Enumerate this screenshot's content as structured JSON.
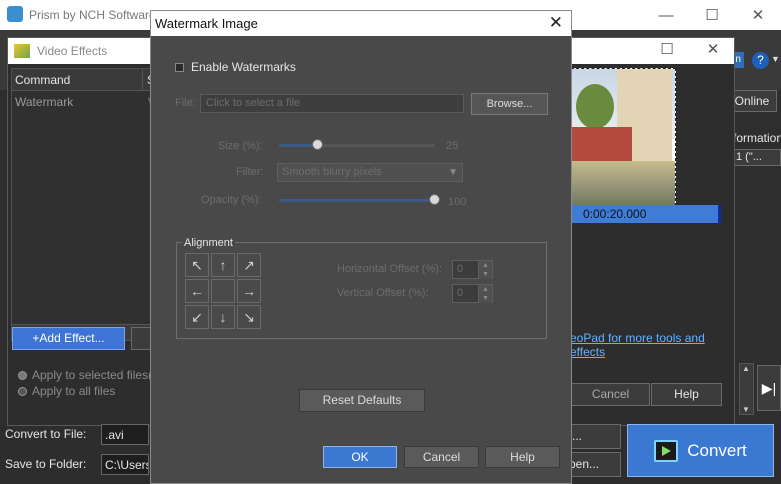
{
  "main_window": {
    "title": "Prism by NCH Software",
    "online_label": "Online",
    "information_label": "formation",
    "dropdown_value": "1 (\"...",
    "convert_to_file_label": "Convert to File:",
    "convert_to_file_value": ".avi",
    "save_to_folder_label": "Save to Folder:",
    "save_to_folder_value": "C:\\Users",
    "browse_small_label": "...",
    "open_small_label": "pen...",
    "convert_label": "Convert"
  },
  "video_effects": {
    "title": "Video Effects",
    "table": {
      "headers": [
        "Command",
        "Se"
      ],
      "rows": [
        [
          "Watermark",
          "W"
        ]
      ]
    },
    "add_effect_label": "+Add Effect...",
    "apply_selected_label": "Apply to selected files(s)",
    "apply_all_label": "Apply to all files",
    "timecode": "0:00:20.000",
    "videopad_link": "eoPad for more tools and effects",
    "cancel_label": "Cancel",
    "help_label": "Help"
  },
  "watermark_dialog": {
    "title": "Watermark Image",
    "enable_label": "Enable Watermarks",
    "file_label": "File:",
    "file_placeholder": "Click to select a file",
    "browse_label": "Browse...",
    "size_label": "Size (%):",
    "size_value": "25",
    "size_fraction": 0.25,
    "filter_label": "Filter:",
    "filter_value": "Smooth blurry pixels",
    "opacity_label": "Opacity (%):",
    "opacity_value": "100",
    "opacity_fraction": 1.0,
    "alignment_label": "Alignment",
    "alignment_arrows": [
      "↖",
      "↑",
      "↗",
      "←",
      "",
      "→",
      "↙",
      "↓",
      "↘"
    ],
    "h_offset_label": "Horizontal Offset (%):",
    "h_offset_value": "0",
    "v_offset_label": "Vertical Offset (%):",
    "v_offset_value": "0",
    "reset_label": "Reset Defaults",
    "ok_label": "OK",
    "cancel_label": "Cancel",
    "help_label": "Help"
  },
  "colors": {
    "accent_blue": "#3a78d2",
    "dialog_bg": "#494949",
    "link_blue": "#6ab1ff"
  }
}
